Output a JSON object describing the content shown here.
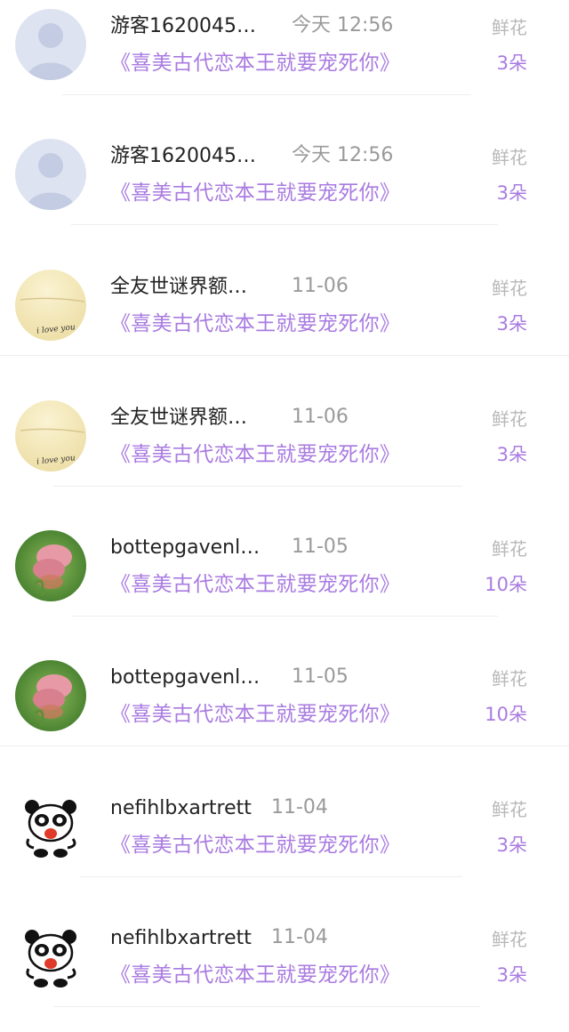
{
  "records": [
    {
      "name": "游客1620045…",
      "time": "今天 12:56",
      "book": "《喜美古代恋本王就要宠死你》",
      "gift_label": "鲜花",
      "gift_count": "3朵",
      "avatar": "default-avatar"
    },
    {
      "name": "游客1620045…",
      "time": "今天 12:56",
      "book": "《喜美古代恋本王就要宠死你》",
      "gift_label": "鲜花",
      "gift_count": "3朵",
      "avatar": "default-avatar"
    },
    {
      "name": "全友世谜界额…",
      "time": "11-06",
      "book": "《喜美古代恋本王就要宠死你》",
      "gift_label": "鲜花",
      "gift_count": "3朵",
      "avatar": "i-love-you-avatar"
    },
    {
      "name": "全友世谜界额…",
      "time": "11-06",
      "book": "《喜美古代恋本王就要宠死你》",
      "gift_label": "鲜花",
      "gift_count": "3朵",
      "avatar": "i-love-you-avatar"
    },
    {
      "name": "bottepgavenl…",
      "time": "11-05",
      "book": "《喜美古代恋本王就要宠死你》",
      "gift_label": "鲜花",
      "gift_count": "10朵",
      "avatar": "tulip-avatar"
    },
    {
      "name": "bottepgavenl…",
      "time": "11-05",
      "book": "《喜美古代恋本王就要宠死你》",
      "gift_label": "鲜花",
      "gift_count": "10朵",
      "avatar": "tulip-avatar"
    },
    {
      "name": "nefihlbxartrett",
      "time": "11-04",
      "book": "《喜美古代恋本王就要宠死你》",
      "gift_label": "鲜花",
      "gift_count": "3朵",
      "avatar": "panda-avatar"
    },
    {
      "name": "nefihlbxartrett",
      "time": "11-04",
      "book": "《喜美古代恋本王就要宠死你》",
      "gift_label": "鲜花",
      "gift_count": "3朵",
      "avatar": "panda-avatar"
    }
  ],
  "avatar_text": {
    "love": "i love you"
  },
  "colors": {
    "accent": "#a97be0",
    "name": "#222222",
    "time": "#9a9a9a",
    "label": "#b8b8b8"
  }
}
